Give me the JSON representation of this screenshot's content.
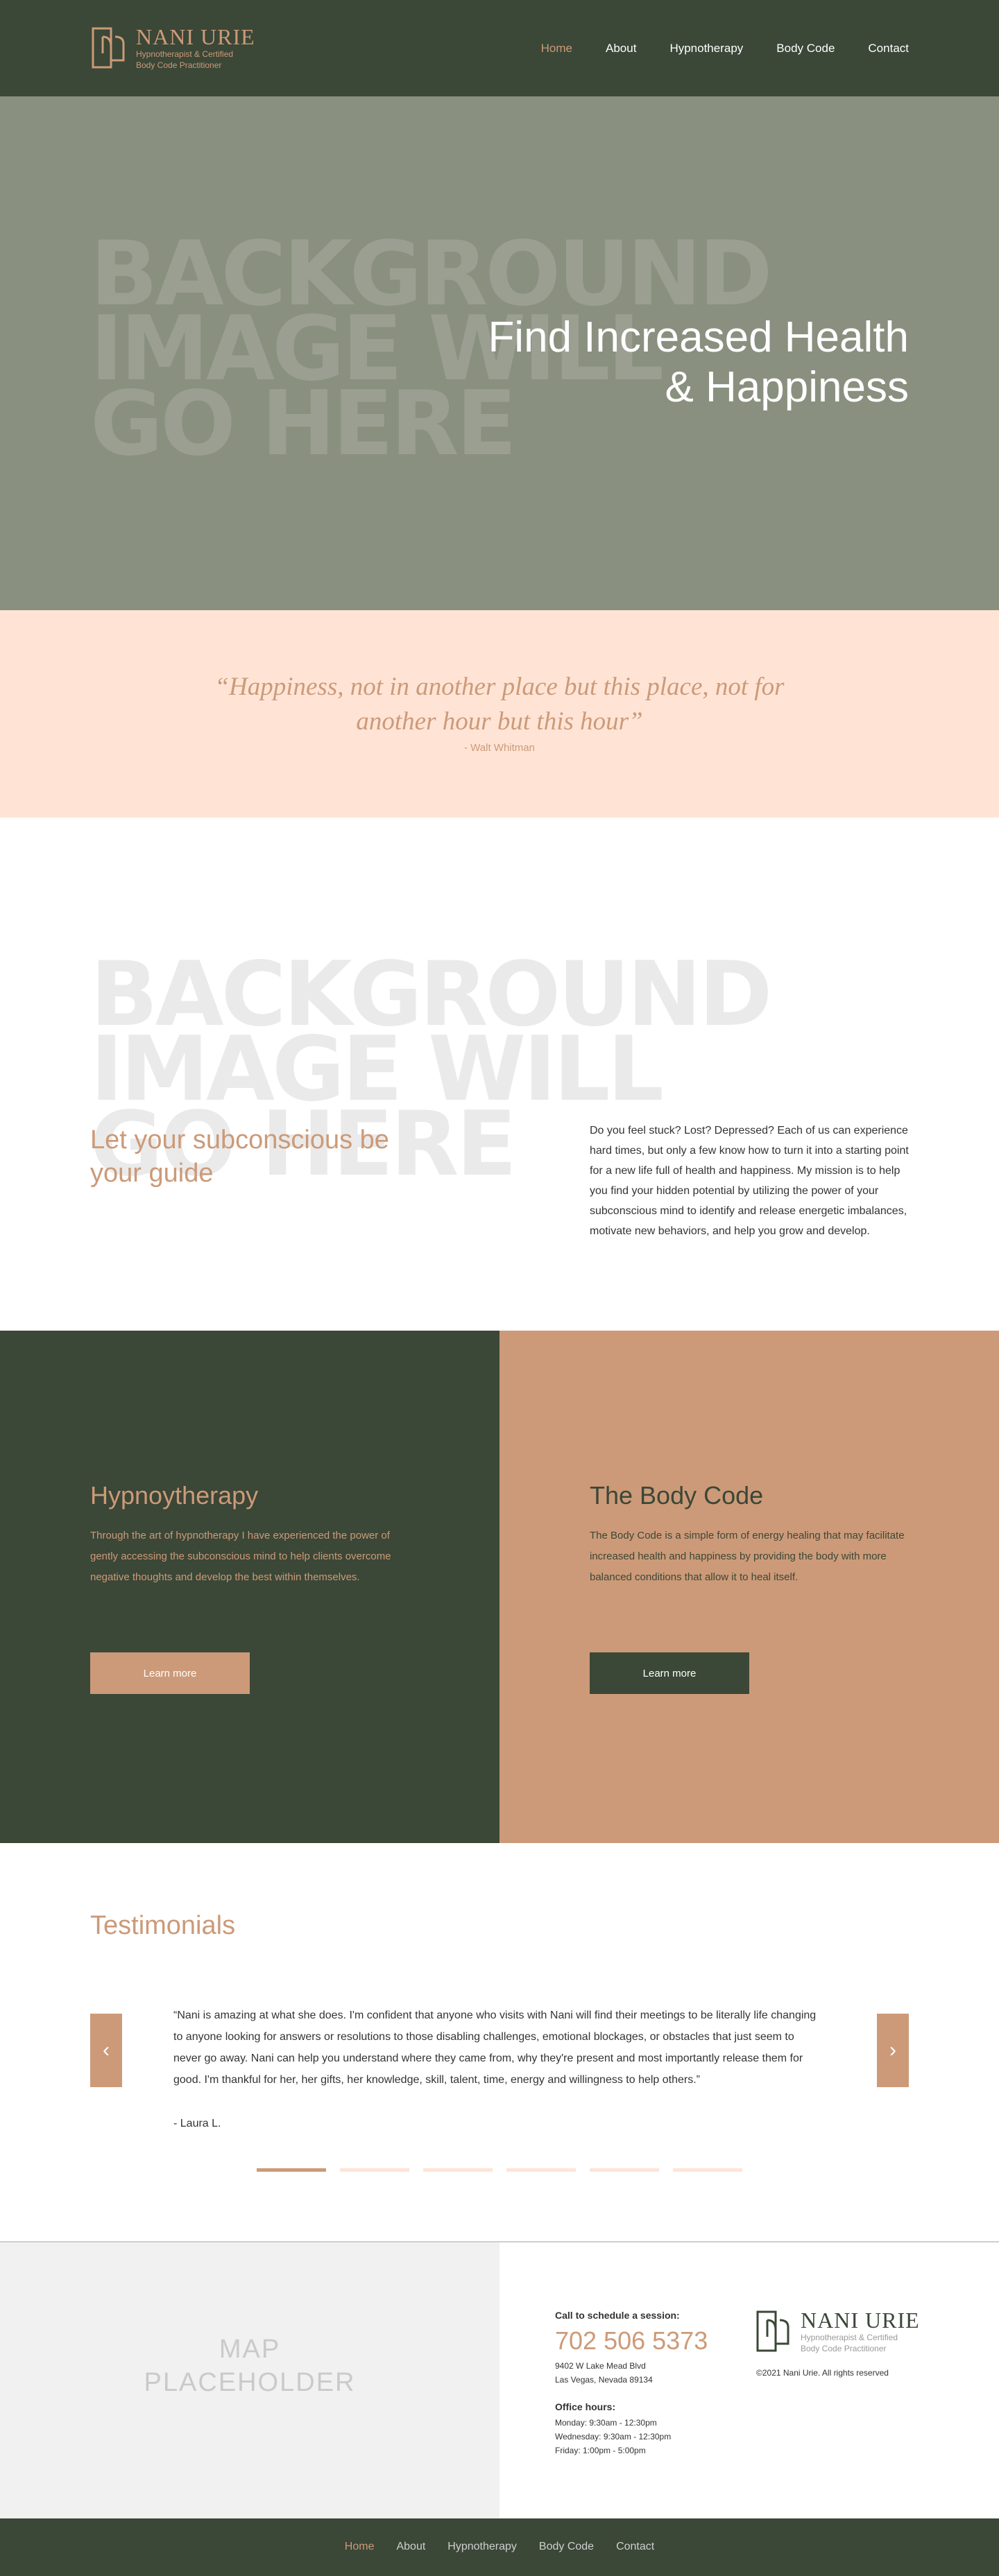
{
  "colors": {
    "dark_green": "#3b4737",
    "accent_tan": "#cc9a78",
    "peach": "#ffe4d6",
    "hero_gray_green": "#89907f"
  },
  "brand": {
    "name": "NANI URIE",
    "tagline_line1": "Hypnotherapist & Certified",
    "tagline_line2": "Body Code Practitioner"
  },
  "nav": {
    "items": [
      {
        "label": "Home",
        "active": true
      },
      {
        "label": "About",
        "active": false
      },
      {
        "label": "Hypnotherapy",
        "active": false
      },
      {
        "label": "Body Code",
        "active": false
      },
      {
        "label": "Contact",
        "active": false
      }
    ]
  },
  "hero": {
    "placeholder_lines": [
      "BACKGROUND",
      "IMAGE WILL",
      "GO HERE"
    ],
    "title_line1": "Find Increased Health",
    "title_line2": "& Happiness"
  },
  "quote": {
    "text": "“Happiness, not in another place but this place, not for another hour but this hour”",
    "author": "- Walt Whitman"
  },
  "about": {
    "placeholder_lines": [
      "BACKGROUND",
      "IMAGE WILL",
      "GO HERE"
    ],
    "heading": "Let your subconscious be your guide",
    "body": "Do you feel stuck? Lost? Depressed? Each of us can experience hard times, but only a few know how to turn it into a starting point for a new life full of health and happiness. My mission is to help you find your hidden potential by utilizing the power of your subconscious mind to identify and release energetic imbalances, motivate new behaviors, and help you grow and develop."
  },
  "services": {
    "hypnotherapy": {
      "title": "Hypnoytherapy",
      "body": "Through the art of hypnotherapy I have experienced the power of gently accessing the subconscious mind to help clients overcome negative thoughts and develop the best within themselves.",
      "button": "Learn more"
    },
    "body_code": {
      "title": "The Body Code",
      "body": "The Body Code is a simple form of energy healing that may facilitate increased health and happiness by providing the body with more balanced conditions that allow it to heal itself.",
      "button": "Learn more"
    }
  },
  "testimonials": {
    "heading": "Testimonials",
    "prev_icon": "chevron-left-icon",
    "next_icon": "chevron-right-icon",
    "prev_glyph": "‹",
    "next_glyph": "›",
    "quote": "“Nani is amazing at what she does. I'm confident that anyone who visits with Nani will find their meetings to be literally life changing to anyone looking for answers or resolutions to those disabling challenges, emotional blockages, or obstacles that just seem to never go away. Nani can help you understand where they came from, why they're present and most importantly release them for good. I'm thankful for her, her gifts, her knowledge, skill, talent, time, energy and willingness to help others.”",
    "author": "- Laura L.",
    "slide_count": 6,
    "active_slide": 1
  },
  "contact": {
    "map_label_line1": "MAP",
    "map_label_line2": "PLACEHOLDER",
    "schedule_label": "Call to schedule a session:",
    "phone": "702 506 5373",
    "address_line1": "9402 W Lake Mead Blvd",
    "address_line2": "Las Vegas, Nevada 89134",
    "hours_label": "Office hours:",
    "hours": [
      "Monday: 9:30am - 12:30pm",
      "Wednesday: 9:30am - 12:30pm",
      "Friday: 1:00pm - 5:00pm"
    ],
    "copyright": "©2021 Nani Urie. All rights reserved"
  },
  "footer_nav": {
    "items": [
      {
        "label": "Home",
        "active": true
      },
      {
        "label": "About",
        "active": false
      },
      {
        "label": "Hypnotherapy",
        "active": false
      },
      {
        "label": "Body Code",
        "active": false
      },
      {
        "label": "Contact",
        "active": false
      }
    ]
  }
}
